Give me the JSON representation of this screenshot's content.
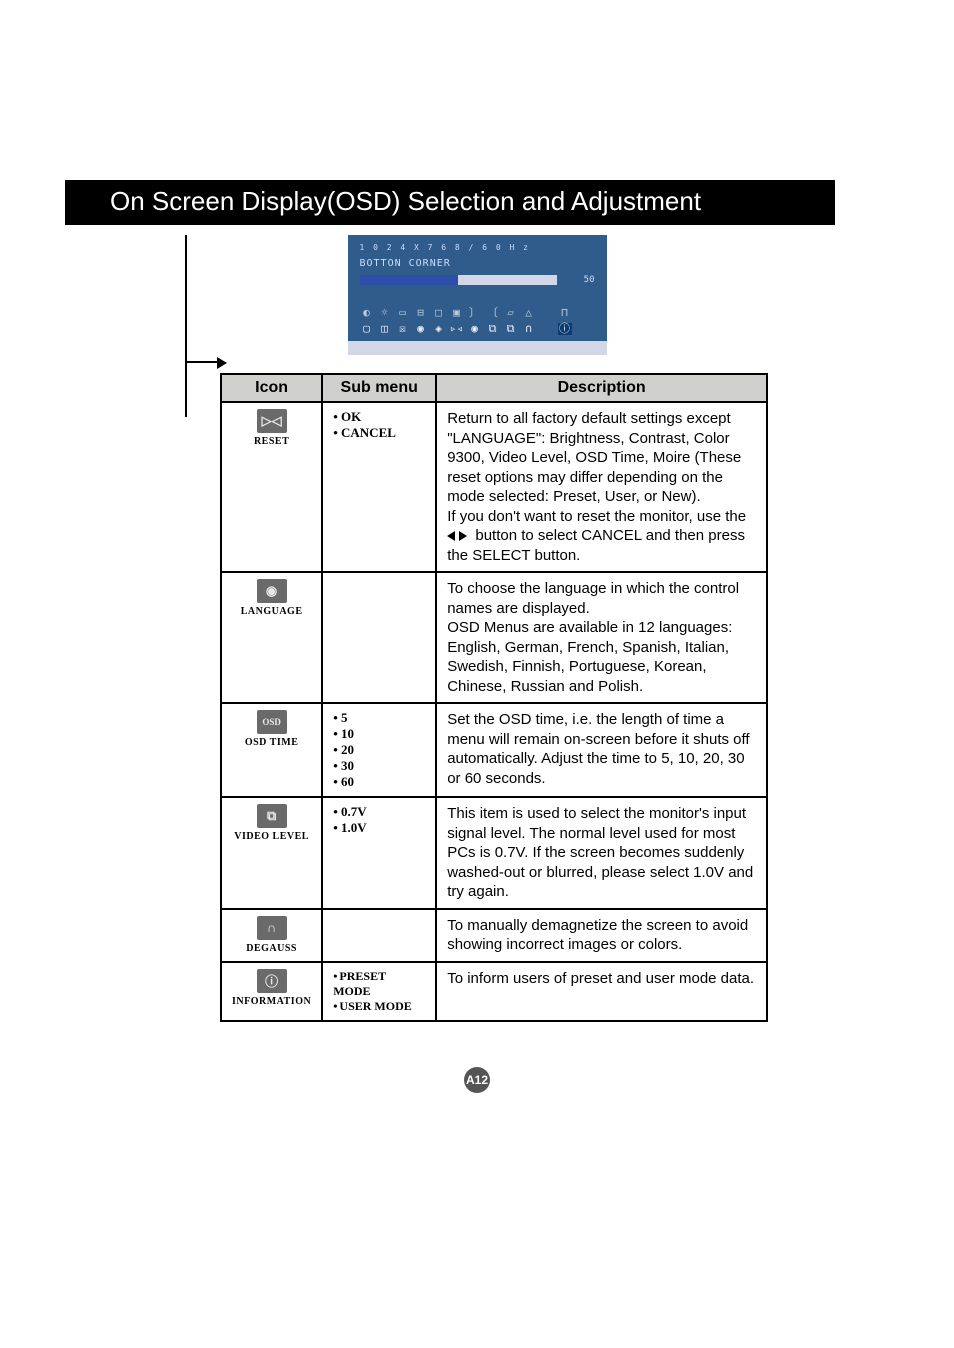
{
  "header": {
    "title": "On Screen Display(OSD) Selection and Adjustment"
  },
  "osd": {
    "resolution": "1 0 2 4 X 7 6 8 / 6 0 H z",
    "label": "BOTTON CORNER",
    "value": "50"
  },
  "table": {
    "headers": {
      "icon": "Icon",
      "sub": "Sub menu",
      "desc": "Description"
    },
    "rows": [
      {
        "icon_glyph": "▷◁",
        "icon_name": "reset-icon",
        "icon_caption": "RESET",
        "sub": [
          "OK",
          "CANCEL"
        ],
        "desc_pre": "Return to all factory default settings except \"LANGUAGE\": Brightness, Contrast, Color 9300, Video Level, OSD Time, Moire (These reset options may differ depending on the mode selected: Preset, User, or New).\nIf you don't want to reset the monitor, use the",
        "desc_post": "button to select CANCEL and then press the SELECT button."
      },
      {
        "icon_glyph": "◉",
        "icon_name": "language-icon",
        "icon_caption": "LANGUAGE",
        "sub": [],
        "desc": "To choose the language in which the control names are displayed.\nOSD Menus are available in 12 languages: English, German, French, Spanish, Italian, Swedish, Finnish, Portuguese, Korean, Chinese, Russian and Polish."
      },
      {
        "icon_glyph": "OSD",
        "icon_name": "osdtime-icon",
        "icon_caption": "OSD TIME",
        "sub": [
          "5",
          "10",
          "20",
          "30",
          "60"
        ],
        "desc": "Set the OSD time, i.e. the length of time a menu will remain on-screen before it shuts off automatically. Adjust the time to 5, 10, 20, 30 or 60 seconds."
      },
      {
        "icon_glyph": "⧉",
        "icon_name": "videolevel-icon",
        "icon_caption": "VIDEO LEVEL",
        "sub": [
          "0.7V",
          "1.0V"
        ],
        "desc": "This item is used to select the monitor's input signal level. The normal level used for most PCs is 0.7V. If the screen becomes suddenly washed-out or blurred, please select 1.0V and try again."
      },
      {
        "icon_glyph": "∩",
        "icon_name": "degauss-icon",
        "icon_caption": "DEGAUSS",
        "sub": [],
        "desc": "To manually demagnetize the screen to avoid showing incorrect images or colors."
      },
      {
        "icon_glyph": "ⓘ",
        "icon_name": "information-icon",
        "icon_caption": "INFORMATION",
        "sub": [
          "PRESET MODE",
          "USER MODE"
        ],
        "sub_small": true,
        "desc": "To inform users of preset and user mode data."
      }
    ]
  },
  "page_number": "A12"
}
